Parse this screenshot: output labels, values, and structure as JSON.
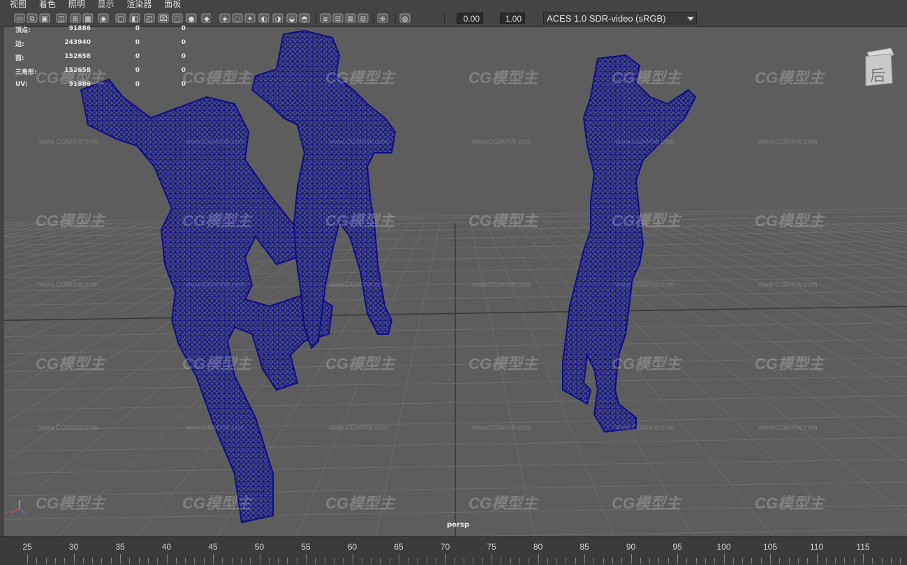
{
  "menu": [
    "视图",
    "着色",
    "照明",
    "显示",
    "渲染器",
    "面板"
  ],
  "toolbar": {
    "exposure_value": "0.00",
    "gamma_value": "1.00",
    "colorspace": "ACES 1.0 SDR-video (sRGB)",
    "icons": [
      "camera-select-icon",
      "camera-attributes-icon",
      "bookmark-icon",
      "image-plane-icon",
      "grid-icon",
      "film-gate-icon",
      "resolution-gate-icon",
      "gate-mask-icon",
      "field-chart-icon",
      "safe-action-icon",
      "safe-title-icon",
      "wireframe-icon",
      "smooth-shade-icon",
      "flat-shade-icon",
      "shaded-wireframe-icon",
      "xray-icon",
      "default-light-icon",
      "shadows-icon",
      "ao-icon",
      "motion-blur-icon",
      "anti-alias-icon",
      "isolate-icon",
      "xray-joints-icon",
      "xray-active-icon",
      "exposure-icon",
      "gamma-icon",
      "color-management-icon"
    ]
  },
  "hud": {
    "rows": [
      {
        "label": "顶点:",
        "v1": "91886",
        "v2": "0",
        "v3": "0"
      },
      {
        "label": "边:",
        "v1": "243940",
        "v2": "0",
        "v3": "0"
      },
      {
        "label": "面:",
        "v1": "152658",
        "v2": "0",
        "v3": "0"
      },
      {
        "label": "三角形:",
        "v1": "152658",
        "v2": "0",
        "v3": "0"
      },
      {
        "label": "UV:",
        "v1": "91886",
        "v2": "0",
        "v3": "0"
      }
    ]
  },
  "viewcube": {
    "face": "后"
  },
  "camera": "persp",
  "timeline": {
    "ticks": [
      "25",
      "30",
      "35",
      "40",
      "45",
      "50",
      "55",
      "60",
      "65",
      "70",
      "75",
      "80",
      "85",
      "90",
      "95",
      "100",
      "105",
      "110",
      "115"
    ]
  },
  "watermark": {
    "logo": "CG模型主",
    "url": "www.CGMXW.com"
  },
  "colors": {
    "wireframe": "#0d0d8a",
    "viewport_bg": "#5d5d5d",
    "grid": "#6b6b6b",
    "ui_bg": "#444444"
  }
}
